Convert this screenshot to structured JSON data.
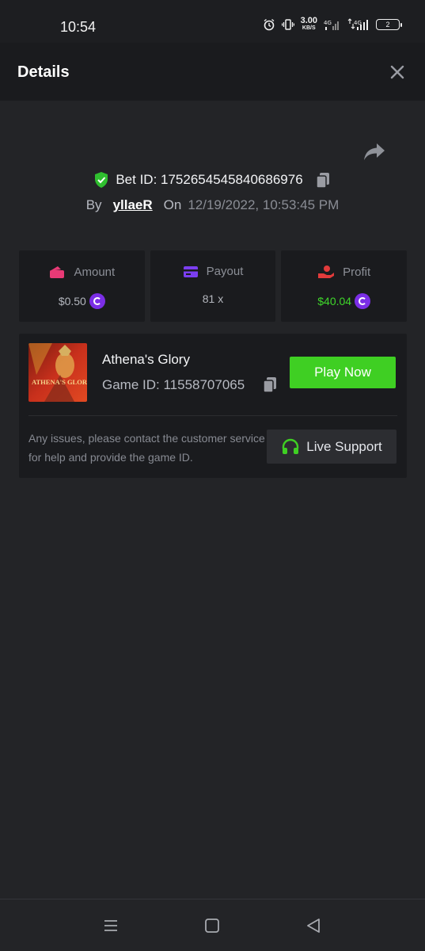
{
  "status_bar": {
    "time": "10:54",
    "speed_value": "3.00",
    "speed_unit": "KB/S",
    "network_1": "4G",
    "network_2": "4G",
    "battery": "2"
  },
  "header": {
    "title": "Details",
    "close_icon": "close-icon"
  },
  "bet": {
    "label": "Bet ID: 1752654545840686976",
    "by_label": "By",
    "user": "yllaeR",
    "on_label": "On",
    "datetime": "12/19/2022, 10:53:45 PM"
  },
  "stats": [
    {
      "label": "Amount",
      "value": "$0.50",
      "icon": "wallet-icon",
      "color": "#e83a76",
      "has_coin": true
    },
    {
      "label": "Payout",
      "value": "81 x",
      "icon": "card-icon",
      "color": "#7b3ef0",
      "has_coin": false
    },
    {
      "label": "Profit",
      "value": "$40.04",
      "icon": "hand-coin-icon",
      "color": "#e23b3b",
      "has_coin": true
    }
  ],
  "game": {
    "name": "Athena's Glory",
    "id_label": "Game ID: 11558707065",
    "thumbnail_text": "ATHENA'S GLORY",
    "play_label": "Play Now",
    "help_text": "Any issues, please contact the customer service for help and provide the game ID.",
    "support_label": "Live Support"
  },
  "colors": {
    "accent_green": "#3fcf23",
    "coin_purple": "#7b2ee6",
    "background": "#232427",
    "card": "#1a1b1e"
  }
}
